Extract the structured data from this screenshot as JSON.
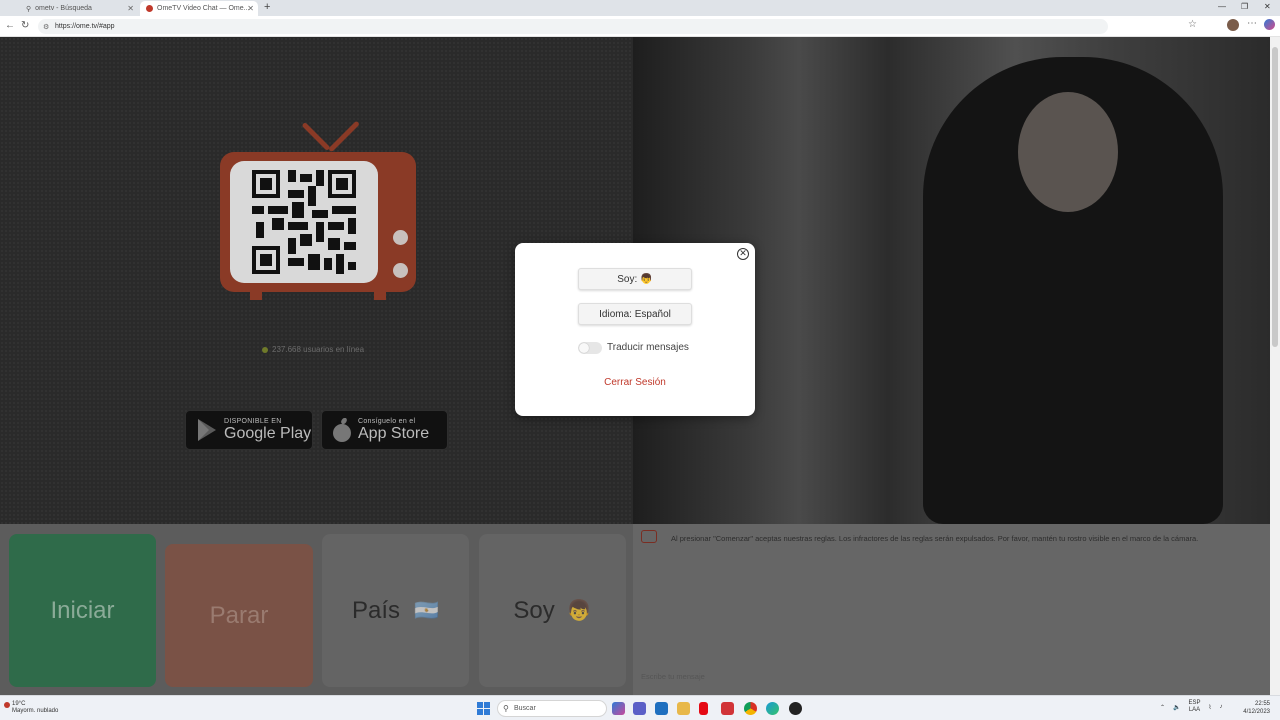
{
  "browser": {
    "tabs": [
      {
        "label": "ometv - Búsqueda",
        "active": false
      },
      {
        "label": "OmeTV Video Chat — Ome...",
        "active": true
      }
    ],
    "url": "https://ome.tv/#app"
  },
  "promo": {
    "online_count": "237.668 usuarios en línea",
    "google_play": {
      "small": "DISPONIBLE EN",
      "big": "Google Play"
    },
    "app_store": {
      "small": "Consíguelo en el",
      "big": "App Store"
    }
  },
  "controls": {
    "start_label": "Iniciar",
    "stop_label": "Parar",
    "country_label": "País",
    "country_flag": "🇦🇷",
    "gender_label": "Soy",
    "gender_icon": "👦"
  },
  "chat": {
    "rules_message": "Al presionar \"Comenzar\" aceptas nuestras reglas. Los infractores de las reglas serán expulsados. Por favor, mantén tu rostro visible en el marco de la cámara.",
    "input_placeholder": "Escribe tu mensaje"
  },
  "modal": {
    "gender_button": "Soy:",
    "gender_icon": "👦",
    "language_button": "Idioma: Español",
    "translate_label": "Traducir mensajes",
    "translate_enabled": false,
    "logout_label": "Cerrar Sesión",
    "close_icon": "close-circle-icon"
  },
  "taskbar": {
    "weather_temp": "19°C",
    "weather_desc": "Mayorm. nublado",
    "search_placeholder": "Buscar",
    "tray_lang": "ESP",
    "tray_region": "LAA",
    "time": "22:55",
    "date": "4/12/2023"
  },
  "colors": {
    "accent_red": "#c0392b",
    "start_green": "#2f6b4a",
    "stop_orange": "#7a5246"
  }
}
